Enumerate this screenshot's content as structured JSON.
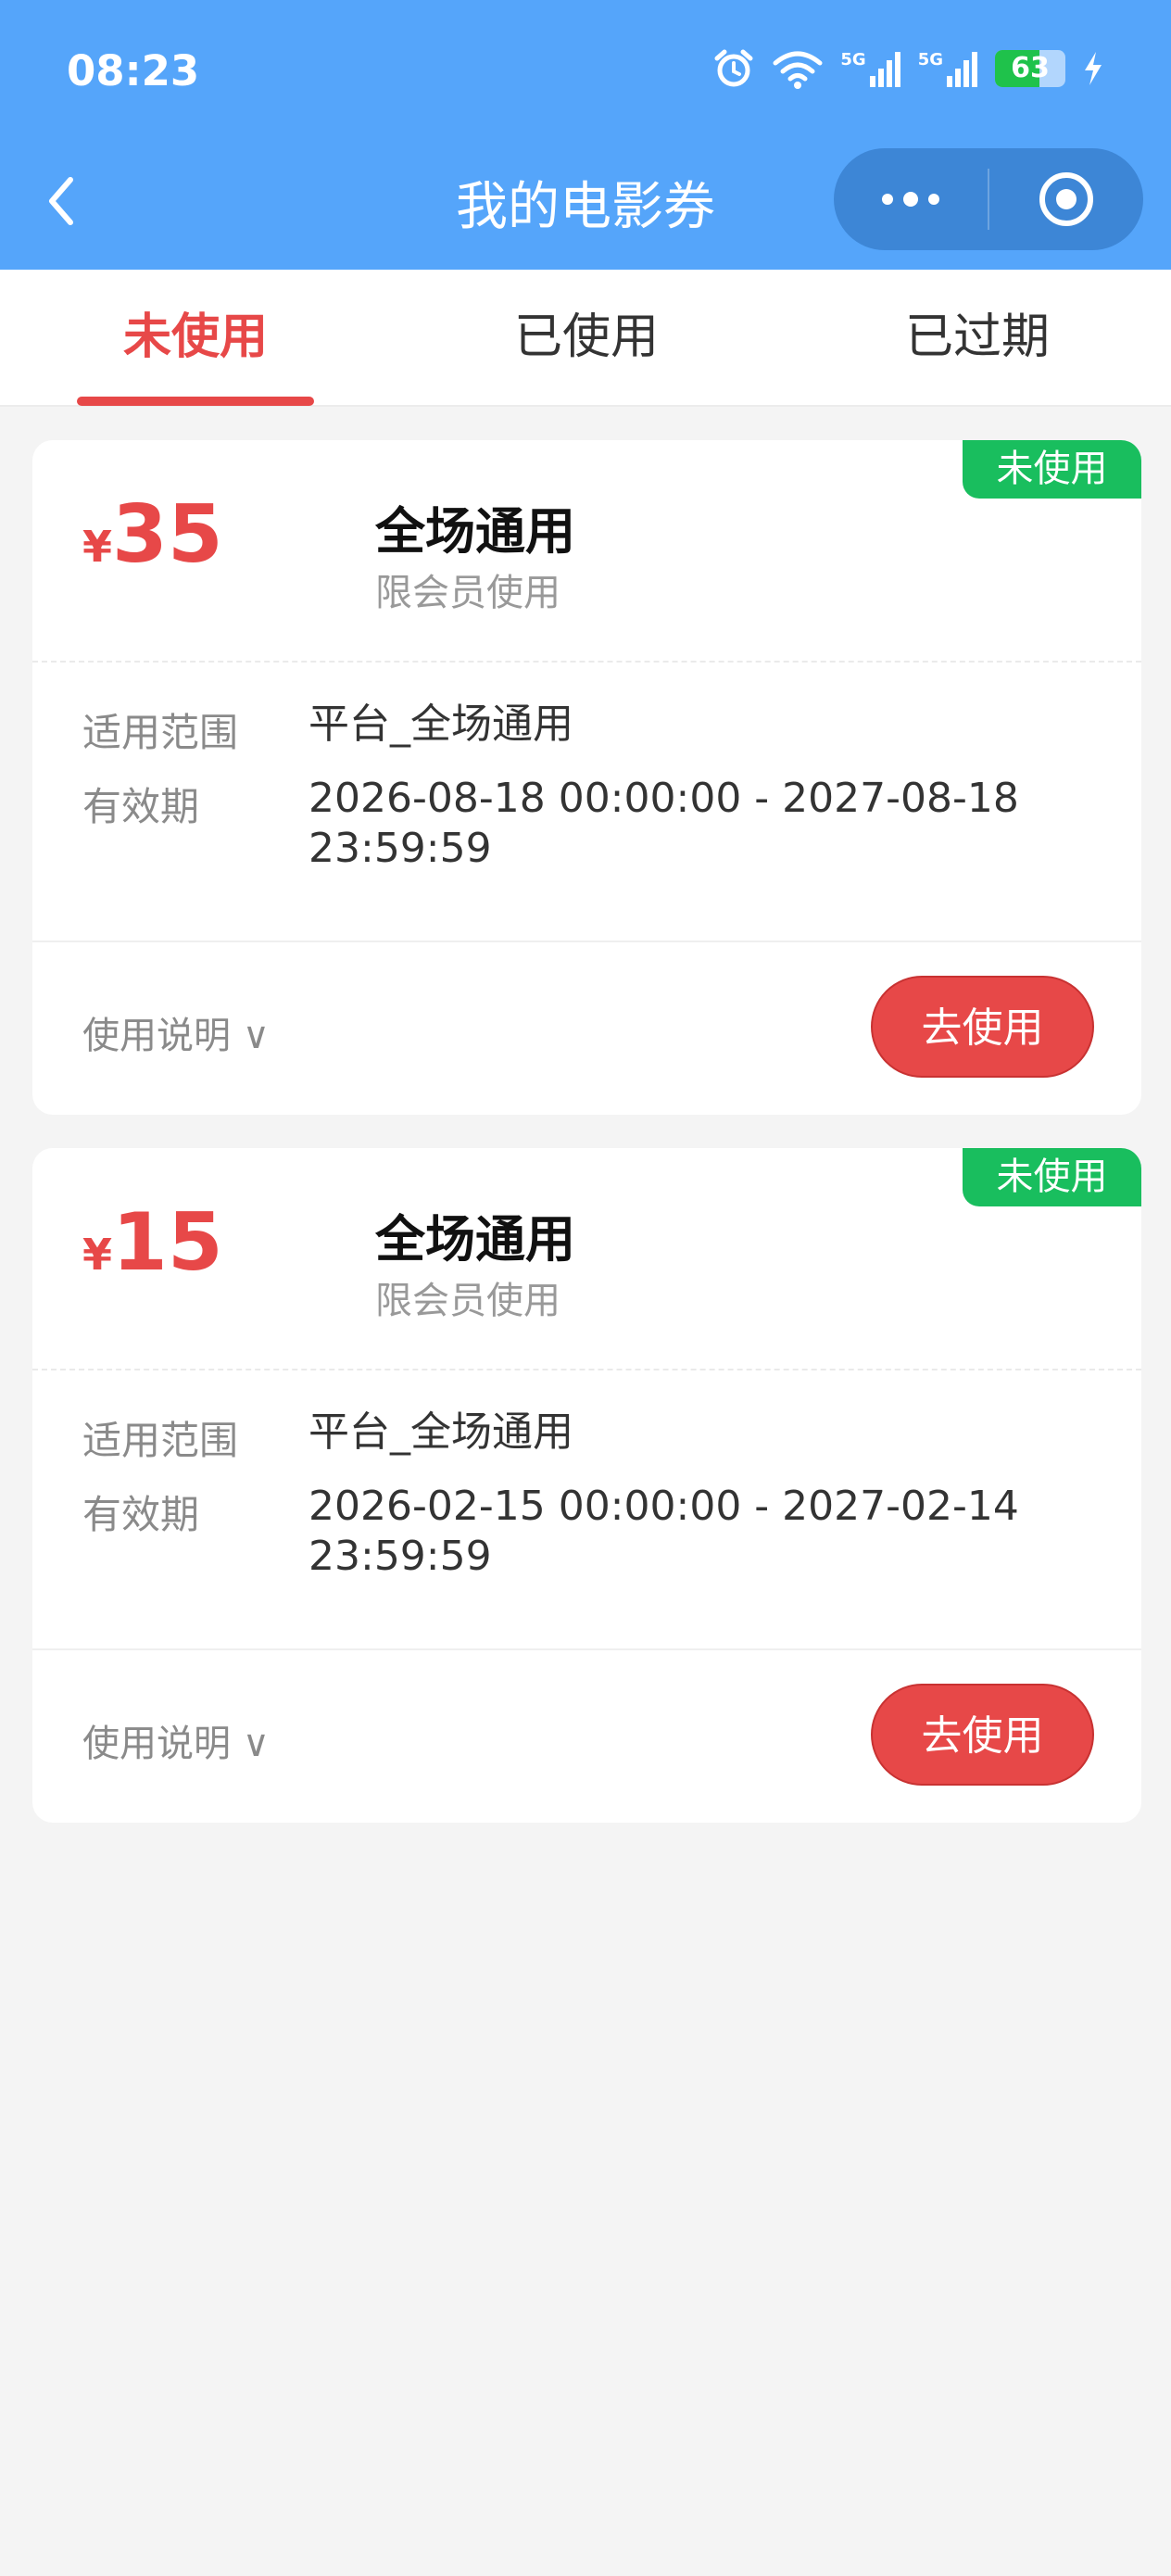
{
  "status_bar": {
    "time": "08:23",
    "signal_1_label": "5G",
    "signal_2_label": "5G",
    "battery": "63"
  },
  "nav": {
    "title": "我的电影券"
  },
  "tabs": [
    {
      "label": "未使用",
      "active": true
    },
    {
      "label": "已使用",
      "active": false
    },
    {
      "label": "已过期",
      "active": false
    }
  ],
  "coupons": [
    {
      "status_badge": "未使用",
      "currency": "¥",
      "amount": "35",
      "name": "全场通用",
      "restriction": "限会员使用",
      "scope_label": "适用范围",
      "scope_value": "平台_全场通用",
      "validity_label": "有效期",
      "validity_value": "2026-08-18 00:00:00 - 2027-08-18 23:59:59",
      "instructions_label": "使用说明 ∨",
      "use_button": "去使用"
    },
    {
      "status_badge": "未使用",
      "currency": "¥",
      "amount": "15",
      "name": "全场通用",
      "restriction": "限会员使用",
      "scope_label": "适用范围",
      "scope_value": "平台_全场通用",
      "validity_label": "有效期",
      "validity_value": "2026-02-15 00:00:00 - 2027-02-14 23:59:59",
      "instructions_label": "使用说明 ∨",
      "use_button": "去使用"
    }
  ],
  "colors": {
    "header": "#55a5fa",
    "accent": "#e74848",
    "badge": "#19be5e"
  }
}
